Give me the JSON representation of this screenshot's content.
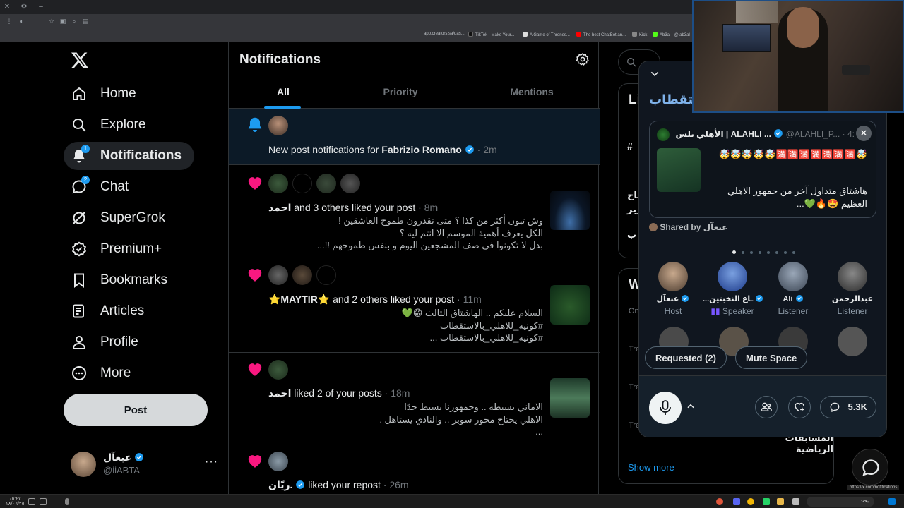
{
  "browser": {
    "bookmarks": [
      {
        "label": "app.creators.sa/das...",
        "color": "#5f6368"
      },
      {
        "label": "TikTok - Make Your...",
        "color": "#111111"
      },
      {
        "label": "A Game of Thrones...",
        "color": "#c0392b"
      },
      {
        "label": "The best ChatBot an...",
        "color": "#ff0000"
      },
      {
        "label": "Kick",
        "color": "#53fc18"
      },
      {
        "label": "Ab3al - @iab3al",
        "color": "#888888"
      }
    ],
    "status_url": "https://x.com/notifications"
  },
  "sidebar": {
    "items": [
      {
        "label": "Home",
        "icon": "home-icon"
      },
      {
        "label": "Explore",
        "icon": "search-icon"
      },
      {
        "label": "Notifications",
        "icon": "bell-icon",
        "badge": "1"
      },
      {
        "label": "Chat",
        "icon": "chat-icon",
        "badge": "2"
      },
      {
        "label": "SuperGrok",
        "icon": "grok-icon"
      },
      {
        "label": "Premium+",
        "icon": "premium-icon"
      },
      {
        "label": "Bookmarks",
        "icon": "bookmark-icon"
      },
      {
        "label": "Articles",
        "icon": "articles-icon"
      },
      {
        "label": "Profile",
        "icon": "person-icon"
      },
      {
        "label": "More",
        "icon": "more-circle-icon"
      }
    ],
    "post_label": "Post",
    "account": {
      "name": "عبعآل",
      "handle": "@iiABTA",
      "more": "···"
    }
  },
  "main": {
    "title": "Notifications",
    "tabs": [
      "All",
      "Priority",
      "Mentions"
    ],
    "notifications": [
      {
        "type": "new-post",
        "prefix": "New post notifications for ",
        "name": "Fabrizio Romano",
        "time": "· 2m"
      },
      {
        "type": "like",
        "actor": "احمد",
        "action": " and 3 others liked your post",
        "time": " · 8m",
        "lines": [
          "وش تبون أكثر من كذا ؟ متى تقدرون طموح العاشقين !",
          "الكل يعرف أهمية الموسم الا انتم ليه ؟",
          "بدل لا تكونوا في صف المشجعين اليوم و بنفس طموحهم !!..."
        ]
      },
      {
        "type": "like",
        "actor": "⭐MAYTIR⭐",
        "action": " and 2 others liked your post",
        "time": " · 11m",
        "lines": [
          "السلام عليكم .. الهاشتاق الثالث 😁💚",
          "#كونيه_للاهلي_بالاستقطاب",
          "#كونيه_للاهلي_بالاستقطاب ..."
        ]
      },
      {
        "type": "like",
        "actor": "احمد",
        "action": " liked 2 of your posts",
        "time": " · 18m",
        "lines": [
          "الاماني بسيطه .. وجمهورنا بسيط جدًا",
          "الاهلي يحتاج محور سوبر .. والنادي يستاهل .",
          "..."
        ]
      },
      {
        "type": "like",
        "actor": "ريّان.",
        "action": " liked your repost",
        "time": " · 26m",
        "lines": []
      }
    ]
  },
  "right": {
    "card1_title": "Li",
    "card2_title": "W",
    "side_snips": [
      "#",
      "فاح",
      "رير",
      "ب",
      "On",
      "Tre",
      "Tre",
      "Tre"
    ],
    "trend_label": "المسابقات الرياضية",
    "show_more": "Show more"
  },
  "space": {
    "title": "استقطاب",
    "tweet": {
      "author": "الأهلي بلس | ALAHLI ...",
      "handle": "@ALAHLI_P...",
      "time": "· 4:",
      "emoji": "🤯🤯🤯🤯🤯🈵🈵🈵🈵🈵🈵🈵🤯",
      "text": "هاشتاق متداول آخر من جمهور الاهلي العظيم 🤩🔥💚..."
    },
    "shared_by_prefix": "Shared by ",
    "shared_by_name": "عبعآل",
    "participants": [
      {
        "name": "عبعآل",
        "role": "Host"
      },
      {
        "name": "...ـاع النخبتين",
        "role": "Speaker"
      },
      {
        "name": "Ali",
        "role": "Listener"
      },
      {
        "name": "عبدالرحمن",
        "role": "Listener"
      }
    ],
    "requested_label": "Requested (2)",
    "mute_label": "Mute Space",
    "listener_count": "5.3K"
  },
  "taskbar": {
    "clock_time": "٠٥:٤٧",
    "clock_date": "١٨/٠٦/٢٥",
    "search_placeholder": "بحث"
  },
  "colors": {
    "accent": "#1d9bf0",
    "like": "#f91880",
    "bell": "#1d9bf0"
  }
}
